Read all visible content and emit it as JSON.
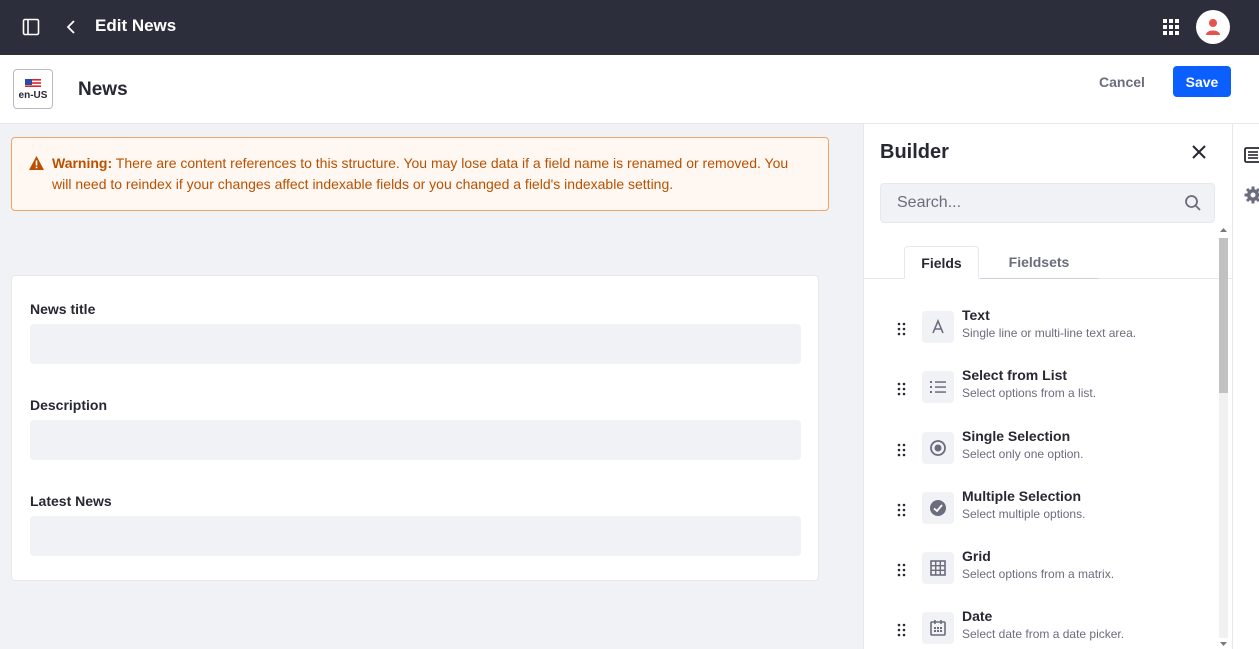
{
  "topbar": {
    "title": "Edit News"
  },
  "header": {
    "locale": "en-US",
    "title": "News",
    "cancel_label": "Cancel",
    "save_label": "Save"
  },
  "warning": {
    "label": "Warning:",
    "message": "There are content references to this structure. You may lose data if a field name is renamed or removed. You will need to reindex if your changes affect indexable fields or you changed a field's indexable setting."
  },
  "form": {
    "fields": [
      {
        "label": "News title",
        "value": ""
      },
      {
        "label": "Description",
        "value": ""
      },
      {
        "label": "Latest News",
        "value": ""
      }
    ]
  },
  "builder": {
    "title": "Builder",
    "search_placeholder": "Search...",
    "tabs": [
      {
        "label": "Fields",
        "active": true
      },
      {
        "label": "Fieldsets",
        "active": false
      }
    ],
    "items": [
      {
        "name": "Text",
        "description": "Single line or multi-line text area.",
        "icon": "text-icon"
      },
      {
        "name": "Select from List",
        "description": "Select options from a list.",
        "icon": "list-icon"
      },
      {
        "name": "Single Selection",
        "description": "Select only one option.",
        "icon": "radio-icon"
      },
      {
        "name": "Multiple Selection",
        "description": "Select multiple options.",
        "icon": "checkbox-icon"
      },
      {
        "name": "Grid",
        "description": "Select options from a matrix.",
        "icon": "grid-icon"
      },
      {
        "name": "Date",
        "description": "Select date from a date picker.",
        "icon": "calendar-icon"
      }
    ]
  },
  "colors": {
    "topbar": "#2c2e3b",
    "primary": "#0b5fff",
    "warning_text": "#b95000",
    "warning_bg": "#fff8f2",
    "warning_border": "#f0a466"
  }
}
